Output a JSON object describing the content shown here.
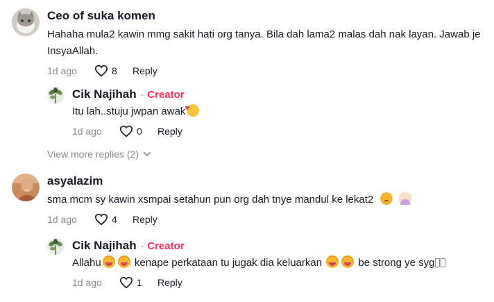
{
  "comments": [
    {
      "username": "Ceo of suka komen",
      "text": "Hahaha mula2 kawin mmg sakit hati org tanya. Bila dah lama2 malas dah nak layan. Jawab je InsyaAllah.",
      "time": "1d ago",
      "likes": "8",
      "reply_label": "Reply",
      "avatar": "cat-avatar"
    },
    {
      "username": "Cik Najihah",
      "separator": "·",
      "badge": "Creator",
      "text": "Itu lah..stuju jwpan awak",
      "time": "1d ago",
      "likes": "0",
      "reply_label": "Reply",
      "avatar": "plant-avatar"
    },
    {
      "username": "asyalazim",
      "text": "sma mcm sy kawin xsmpai setahun pun org dah tnye mandul ke lekat2",
      "time": "1d ago",
      "likes": "4",
      "reply_label": "Reply",
      "avatar": "person-avatar"
    },
    {
      "username": "Cik Najihah",
      "separator": "·",
      "badge": "Creator",
      "text_part1": "Allahu",
      "text_part2": "kenape perkataan tu jugak dia keluarkan",
      "text_part3": "be strong ye syg",
      "time": "1d ago",
      "likes": "1",
      "reply_label": "Reply",
      "avatar": "plant-avatar"
    }
  ],
  "view_more": "View more replies (2)",
  "colors": {
    "creator": "#fe2c55",
    "muted": "#8a8b91",
    "text": "#161823"
  },
  "icons": [
    "heart-icon",
    "chevron-down-icon"
  ]
}
